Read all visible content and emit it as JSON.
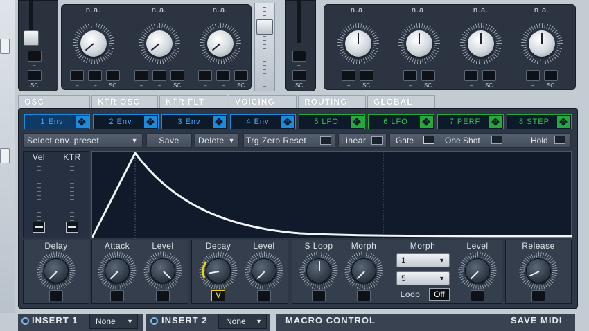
{
  "top": {
    "na_label": "n.a.",
    "dash": "–",
    "sc": "SC"
  },
  "tabs": [
    "OSC",
    "KTR OSC",
    "KTR FLT",
    "VOICING",
    "ROUTING",
    "GLOBAL"
  ],
  "env_tabs": [
    {
      "label": "1 Env",
      "color": "blue"
    },
    {
      "label": "2 Env",
      "color": "blue"
    },
    {
      "label": "3 Env",
      "color": "blue"
    },
    {
      "label": "4 Env",
      "color": "blue"
    },
    {
      "label": "5 LFO",
      "color": "green"
    },
    {
      "label": "6 LFO",
      "color": "green"
    },
    {
      "label": "7 PERF",
      "color": "green"
    },
    {
      "label": "8 STEP",
      "color": "green"
    }
  ],
  "toolbar": {
    "preset": "Select env. preset",
    "save": "Save",
    "delete": "Delete",
    "trg": "Trg Zero Reset",
    "linear": "Linear",
    "gate": "Gate",
    "oneshot": "One Shot",
    "hold": "Hold"
  },
  "sliders": {
    "vel": "Vel",
    "ktr": "KTR"
  },
  "params": {
    "delay": "Delay",
    "attack": "Attack",
    "level": "Level",
    "decay": "Decay",
    "sloop": "S Loop",
    "morph": "Morph",
    "release": "Release",
    "loop": "Loop",
    "loop_val": "Off",
    "v_label": "V",
    "morph_sel1": "1",
    "morph_sel2": "5"
  },
  "bottom": {
    "insert1": "INSERT 1",
    "insert2": "INSERT 2",
    "none": "None",
    "macro": "MACRO CONTROL",
    "savemidi": "SAVE MIDI"
  },
  "colors": {
    "blue_tab": "#1a8ce0",
    "green_tab": "#26a83a",
    "accent_yellow": "#e8d21a",
    "panel": "#2c3442"
  }
}
